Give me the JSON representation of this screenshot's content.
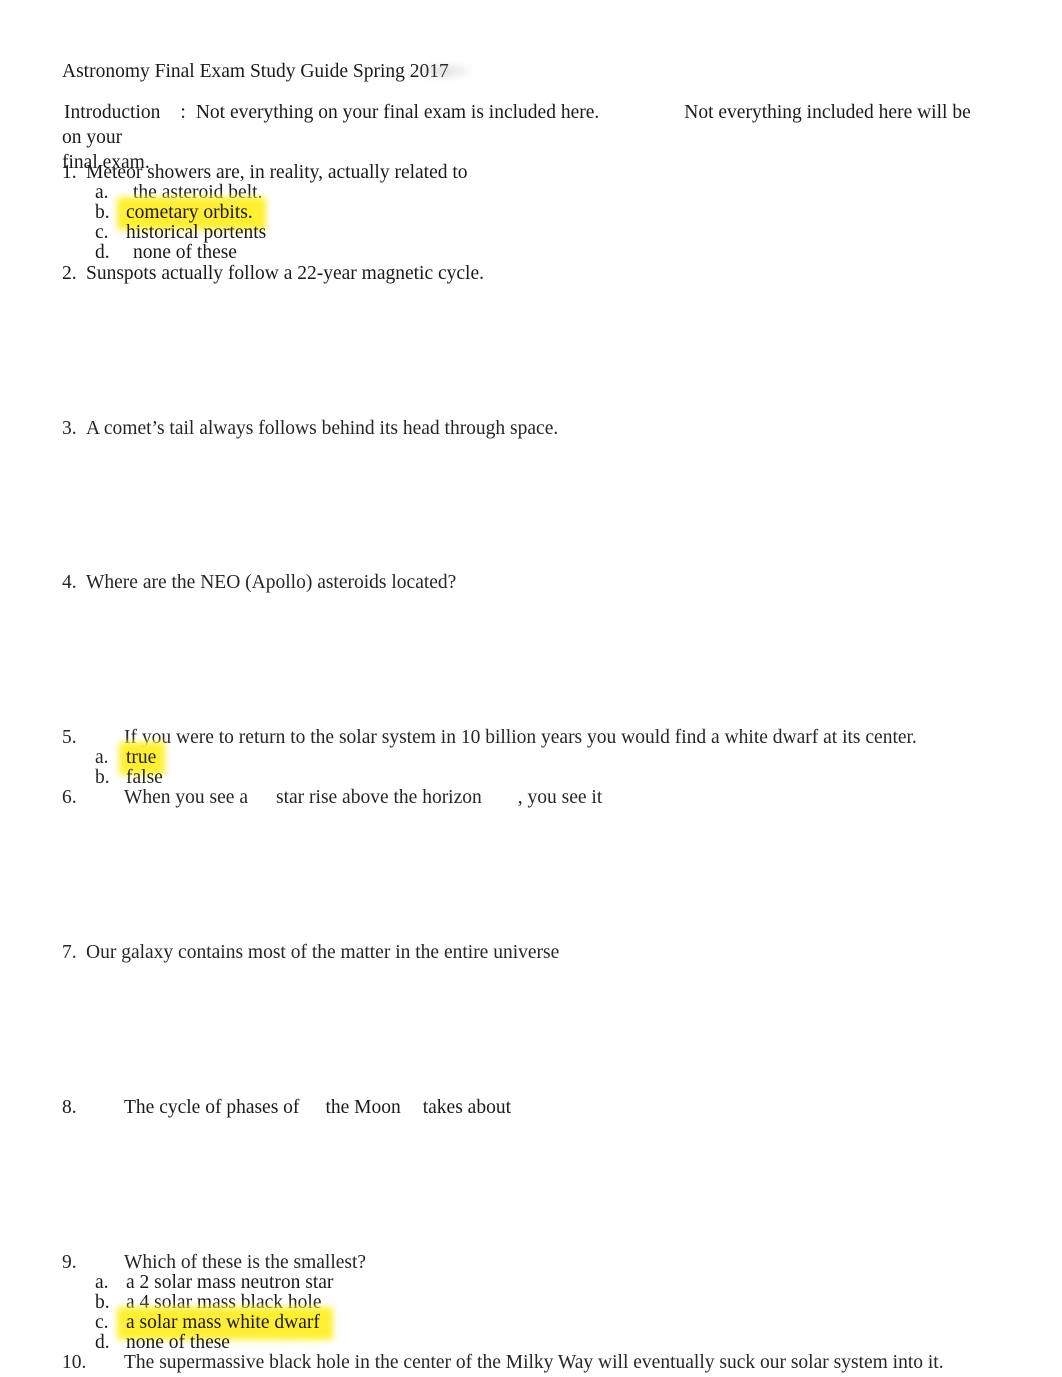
{
  "document": {
    "title": "Astronomy Final Exam Study Guide Spring 2017",
    "intro": {
      "label": "Introduction",
      "colon": ":",
      "sentence_1": "Not everything on your final exam is included here.",
      "sentence_2": "Not everything included here will be on your",
      "sentence_2_cont": "final exam."
    },
    "questions": [
      {
        "number": "1.",
        "text": "Meteor showers are, in reality, actually related to",
        "options": [
          {
            "letter": "a.",
            "text": "the asteroid belt.",
            "highlighted": false
          },
          {
            "letter": "b.",
            "text": "cometary orbits.",
            "highlighted": true
          },
          {
            "letter": "c.",
            "text": "historical portents",
            "highlighted": false
          },
          {
            "letter": "d.",
            "text": "none of these",
            "highlighted": false
          }
        ]
      },
      {
        "number": "2.",
        "text": "Sunspots actually follow a 22-year magnetic cycle.",
        "options": []
      },
      {
        "number": "3.",
        "text": "A comet’s tail always follows behind its head through space.",
        "options": []
      },
      {
        "number": "4.",
        "text": "Where are the NEO (Apollo) asteroids located?",
        "options": []
      },
      {
        "number": "5.",
        "text": "If you were to return to the solar system in 10 billion years you would find a white dwarf at its center.",
        "options": [
          {
            "letter": "a.",
            "text": "true",
            "highlighted": true
          },
          {
            "letter": "b.",
            "text": "false",
            "highlighted": false
          }
        ]
      },
      {
        "number": "6.",
        "text_part_1": "When you see a",
        "text_part_2": "star rise above the horizon",
        "text_part_3": ", you see it",
        "options": []
      },
      {
        "number": "7.",
        "text": "Our galaxy contains most of the matter in the entire universe",
        "options": []
      },
      {
        "number": "8.",
        "text_part_1": "The cycle of phases of",
        "text_part_2": "the Moon",
        "text_part_3": "takes about",
        "options": []
      },
      {
        "number": "9.",
        "text": "Which of these is the smallest?",
        "options": [
          {
            "letter": "a.",
            "text": "a 2 solar mass neutron star",
            "highlighted": false
          },
          {
            "letter": "b.",
            "text": "a 4 solar mass black hole",
            "highlighted": false
          },
          {
            "letter": "c.",
            "text": "a solar mass white dwarf",
            "highlighted": true
          },
          {
            "letter": "d.",
            "text": "none of these",
            "highlighted": false
          }
        ]
      },
      {
        "number": "10.",
        "text": "The supermassive black hole in the center of the Milky Way will eventually suck our solar system into it.",
        "options": []
      }
    ]
  },
  "colors": {
    "page_background": "#ffffff",
    "text": "#1a1a1a",
    "highlight_yellow": "#fff12e",
    "label_shade": "#e8e8e8"
  }
}
